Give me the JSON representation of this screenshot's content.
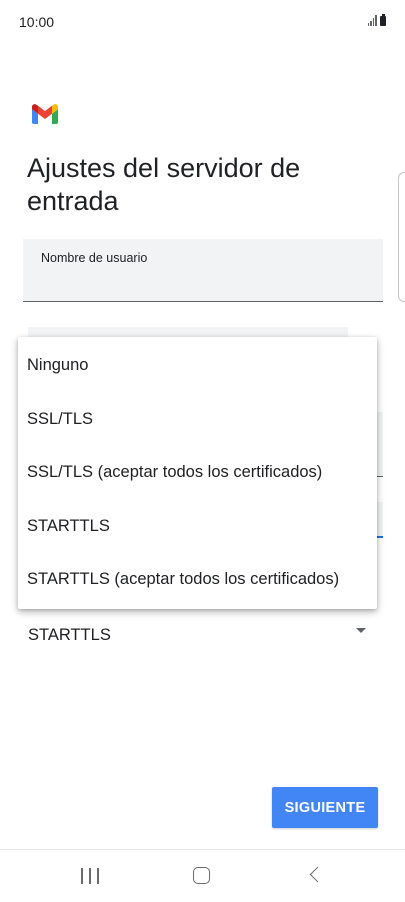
{
  "status_bar": {
    "time": "10:00",
    "signal_icon": "signal-icon",
    "battery_icon": "battery-icon"
  },
  "header": {
    "logo_icon": "gmail-logo-icon",
    "title": "Ajustes del servidor de entrada"
  },
  "form": {
    "username_label": "Nombre de usuario",
    "security_type_value": "STARTTLS"
  },
  "dropdown": {
    "options": [
      "Ninguno",
      "SSL/TLS",
      "SSL/TLS (aceptar todos los certificados)",
      "STARTTLS",
      "STARTTLS (aceptar todos los certificados)"
    ]
  },
  "actions": {
    "next_label": "SIGUIENTE"
  },
  "nav": {
    "recents_icon": "recent-apps-icon",
    "home_icon": "home-icon",
    "back_icon": "back-icon"
  },
  "colors": {
    "accent": "#4285f4",
    "focus_underline": "#1a73e8",
    "field_background": "#f1f3f4"
  }
}
